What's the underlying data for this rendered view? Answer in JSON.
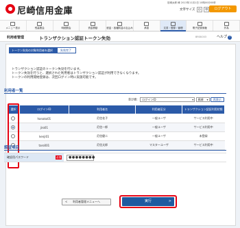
{
  "header": {
    "bank_name": "尼崎信用金庫",
    "user_line": "尼崎太郎 様  2013年11月1日 10時00分00秒",
    "font_size_label": "文字サイズ",
    "font_small": "小",
    "font_medium": "中",
    "font_large": "大",
    "logout_label": "ログアウト"
  },
  "nav": {
    "items": [
      {
        "label": "メニュー表示"
      },
      {
        "label": "残高照会"
      },
      {
        "label": "明細照会"
      },
      {
        "label": "資金移動"
      },
      {
        "label": "税金・各種料金の払込み"
      },
      {
        "label": "承認"
      },
      {
        "label": "文書・登録・管理"
      },
      {
        "label": "電子記録債権"
      },
      {
        "label": "外為"
      }
    ],
    "active_index": 6
  },
  "titlebar": {
    "category": "利用者管理",
    "title": "トランザクション認証トークン失効",
    "code": "BRSK003",
    "help_label": "ヘルプ"
  },
  "steps": {
    "step1": "トークン失効の対象利用者を選択",
    "step2": "失効完了"
  },
  "description": {
    "line1": "トランザクション認証のトークン失効を行います。",
    "line2": "トークン失効を行うと、選択された利用者はトランザクション認証が利用できなくなります。",
    "line3": "トークンの利用開始登録は、次回ログイン時に実施可能です。"
  },
  "user_list": {
    "section_title": "利用者一覧",
    "sort_label": "並び順：",
    "sort_value": "ログインID",
    "order_value": "昇順",
    "sort_button": "再表示",
    "columns": [
      "選択",
      "ログインID",
      "利用者名",
      "利用者区分",
      "トランザクション認証利用状態"
    ],
    "rows": [
      {
        "login_id": "hanako01",
        "name": "尼信花子",
        "type": "一般ユーザ",
        "status": "サービス利用中",
        "selected": false
      },
      {
        "login_id": "jiro01",
        "name": "尼信一郎",
        "type": "一般ユーザ",
        "status": "サービス利用中",
        "selected": true
      },
      {
        "login_id": "kenji01",
        "name": "尼信健二",
        "type": "一般ユーザ",
        "status": "未登録",
        "selected": false
      },
      {
        "login_id": "taro001",
        "name": "尼信太郎",
        "type": "マスターユーザ",
        "status": "サービス利用中",
        "selected": false
      }
    ]
  },
  "auth": {
    "section_title": "認証項目",
    "password_label": "確認用パスワード",
    "required_label": "必須",
    "password_value": "●●●●●●●●"
  },
  "buttons": {
    "back": "利用者管理メニューへ",
    "execute": "実行"
  },
  "colors": {
    "brand_red": "#e60012",
    "accent_blue": "#2b5aa8",
    "logout_orange": "#f39800"
  }
}
